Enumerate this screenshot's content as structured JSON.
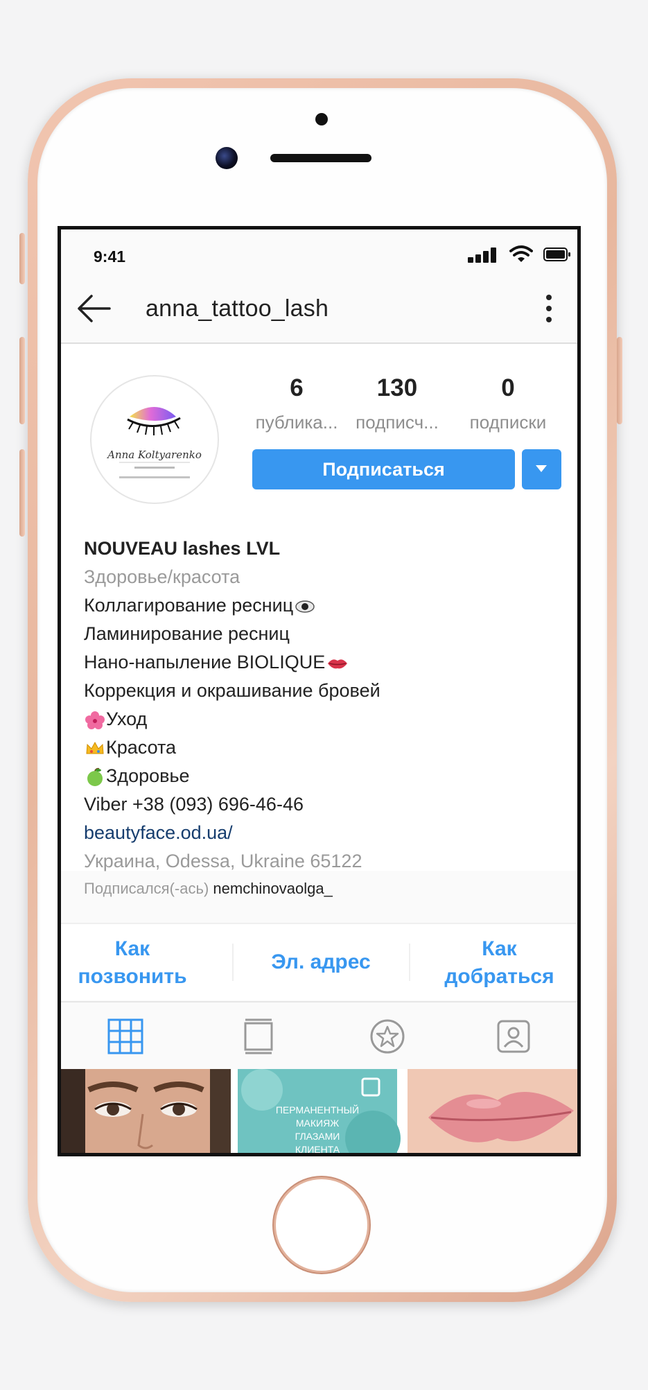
{
  "status_bar": {
    "time": "9:41"
  },
  "nav": {
    "username": "anna_tattoo_lash"
  },
  "avatar": {
    "logo_text": "Anna Koltyarenko",
    "logo_small_text": "Anna Koltyarenko",
    "icon": "eye-lash-logo"
  },
  "stats": [
    {
      "value": "6",
      "label": "публика..."
    },
    {
      "value": "130",
      "label": "подписч..."
    },
    {
      "value": "0",
      "label": "подписки"
    }
  ],
  "follow_button": {
    "label": "Подписаться"
  },
  "bio": {
    "name": "NOUVEAU lashes LVL",
    "category": "Здоровье/красота",
    "lines": [
      "Коллагирование ресниц",
      "Ламинирование ресниц",
      "Нано-напыление BIOLIQUE",
      "Коррекция и окрашивание бровей",
      "Уход",
      "Красота",
      "Здоровье",
      "Viber +38 (093) 696-46-46"
    ],
    "website": "beautyface.od.ua/",
    "location": "Украина, Odessa, Ukraine 65122",
    "followed_by_prefix": "Подписался(-ась)",
    "followed_by_user": "nemchinovaolga_"
  },
  "contacts": {
    "call": [
      "Как",
      "позвонить"
    ],
    "email": "Эл. адрес",
    "directions": [
      "Как",
      "добраться"
    ]
  },
  "tabs": [
    "grid-icon",
    "feed-icon",
    "star-icon",
    "tagged-icon"
  ],
  "grid": {
    "post2_text": [
      "ПЕРМАНЕНТНЫЙ",
      "МАКИЯЖ",
      "ГЛАЗАМИ",
      "КЛИЕНТА"
    ]
  },
  "colors": {
    "accent": "#3897f0",
    "link": "#163d6e",
    "phone_gold": "#e8b79e"
  }
}
